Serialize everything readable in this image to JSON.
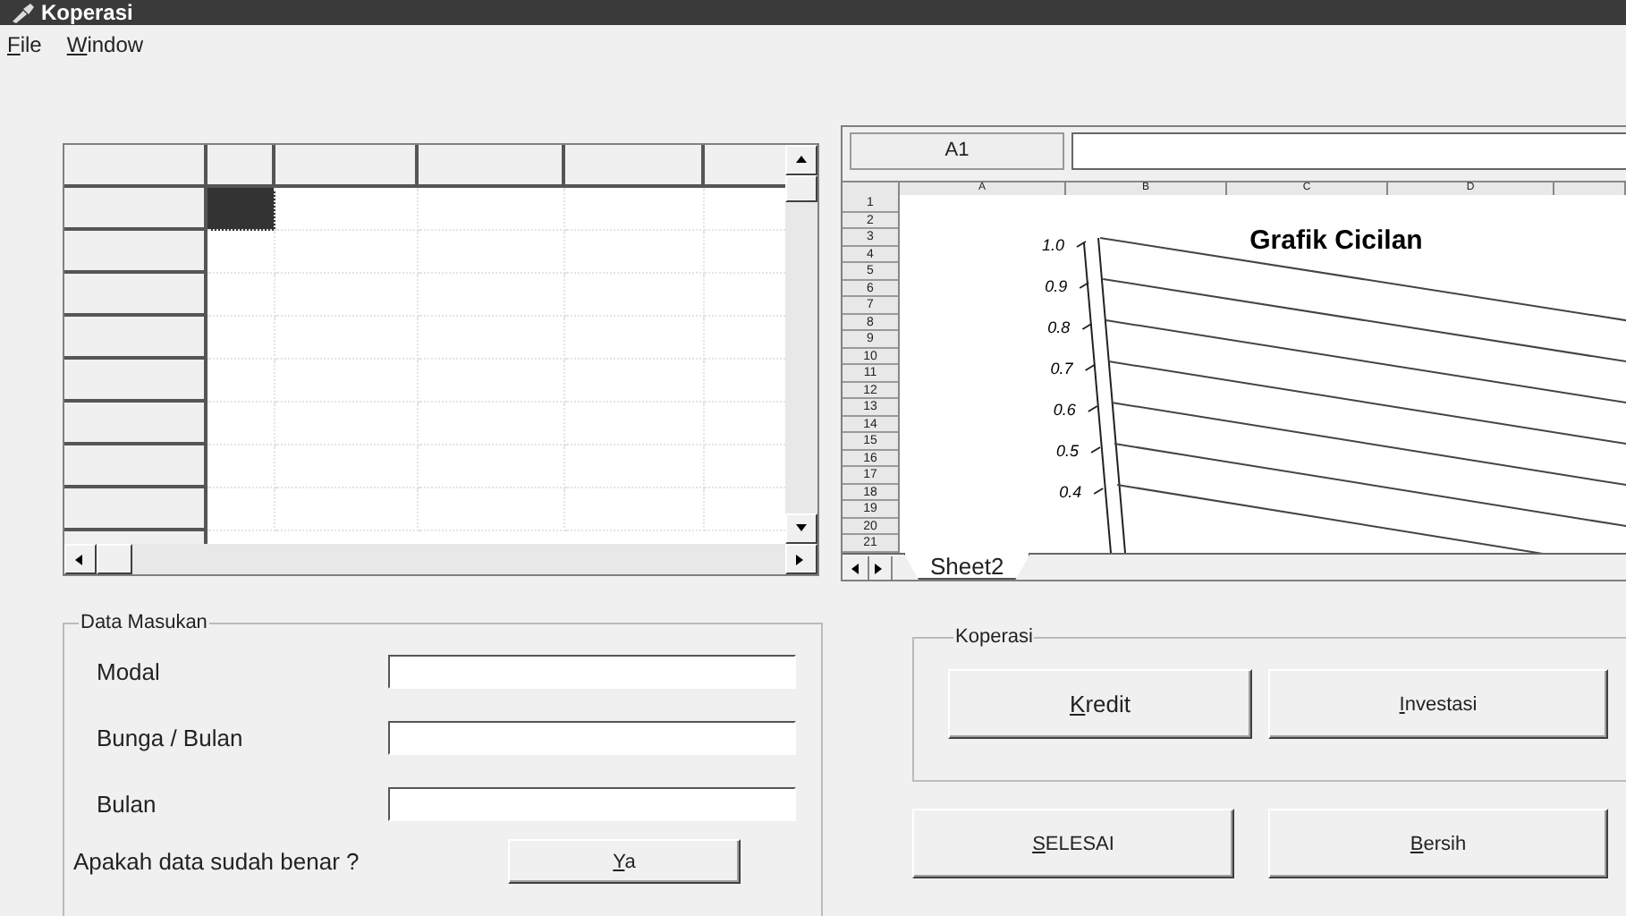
{
  "window": {
    "title": "Koperasi"
  },
  "menu": [
    {
      "access_key": "F",
      "rest": "ile"
    },
    {
      "access_key": "W",
      "rest": "indow"
    }
  ],
  "grid": {
    "rows": [
      {
        "cells": [
          {
            "selected": true
          },
          {
            "selected": false
          },
          {
            "selected": false
          },
          {
            "selected": false
          },
          {
            "selected": false
          }
        ]
      },
      {
        "cells": [
          {
            "selected": false
          },
          {
            "selected": false
          },
          {
            "selected": false
          },
          {
            "selected": false
          },
          {
            "selected": false
          }
        ]
      },
      {
        "cells": [
          {
            "selected": false
          },
          {
            "selected": false
          },
          {
            "selected": false
          },
          {
            "selected": false
          },
          {
            "selected": false
          }
        ]
      },
      {
        "cells": [
          {
            "selected": false
          },
          {
            "selected": false
          },
          {
            "selected": false
          },
          {
            "selected": false
          },
          {
            "selected": false
          }
        ]
      },
      {
        "cells": [
          {
            "selected": false
          },
          {
            "selected": false
          },
          {
            "selected": false
          },
          {
            "selected": false
          },
          {
            "selected": false
          }
        ]
      },
      {
        "cells": [
          {
            "selected": false
          },
          {
            "selected": false
          },
          {
            "selected": false
          },
          {
            "selected": false
          },
          {
            "selected": false
          }
        ]
      },
      {
        "cells": [
          {
            "selected": false
          },
          {
            "selected": false
          },
          {
            "selected": false
          },
          {
            "selected": false
          },
          {
            "selected": false
          }
        ]
      },
      {
        "cells": [
          {
            "selected": false
          },
          {
            "selected": false
          },
          {
            "selected": false
          },
          {
            "selected": false
          },
          {
            "selected": false
          }
        ]
      }
    ]
  },
  "sheet": {
    "cell_ref": "A1",
    "columns": [
      "A",
      "B",
      "C",
      "D"
    ],
    "rows": [
      "1",
      "2",
      "3",
      "4",
      "5",
      "6",
      "7",
      "8",
      "9",
      "10",
      "11",
      "12",
      "13",
      "14",
      "15",
      "16",
      "17",
      "18",
      "19",
      "20",
      "21"
    ],
    "tabs": [
      {
        "label": "Sheet2",
        "selected": true
      }
    ],
    "chart": {
      "title": "Grafik Cicilan",
      "axis_labels": [
        "1.0",
        "0.9",
        "0.8",
        "0.7",
        "0.6",
        "0.5",
        "0.4"
      ]
    }
  },
  "data_entry": {
    "title": "Data Masukan",
    "fields": [
      {
        "label": "Modal"
      },
      {
        "label": "Bunga / Bulan"
      },
      {
        "label": "Bulan"
      }
    ],
    "question": "Apakah data sudah benar ?",
    "confirm": {
      "access_key": "Y",
      "rest": "a"
    }
  },
  "koperasi": {
    "title": "Koperasi",
    "buttons": [
      {
        "access_key": "K",
        "rest": "redit"
      },
      {
        "access_key": "I",
        "rest": "nvestasi"
      }
    ]
  },
  "actions": [
    {
      "access_key": "S",
      "rest": "ELESAI"
    },
    {
      "access_key": "B",
      "rest": "ersih"
    }
  ]
}
